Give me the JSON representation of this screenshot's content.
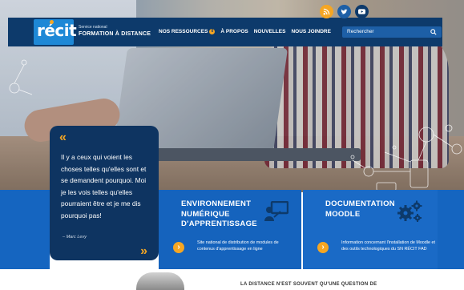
{
  "header": {
    "logo_text": "récit",
    "brand_subtitle": "Service national",
    "brand_title": "FORMATION À DISTANCE",
    "nav_items": [
      {
        "label": "NOS RESSOURCES",
        "badge": "0"
      },
      {
        "label": "À PROPOS"
      },
      {
        "label": "NOUVELLES"
      },
      {
        "label": "NOUS JOINDRE"
      }
    ],
    "search_placeholder": "Rechercher",
    "social": [
      {
        "icon": "rss-icon",
        "color": "#f5a623"
      },
      {
        "icon": "twitter-icon",
        "color": "#1d5fa6"
      },
      {
        "icon": "youtube-icon",
        "color": "#0d3a6b"
      }
    ]
  },
  "quote": {
    "text": "Il y a ceux qui voient les choses telles qu'elles sont et se demandent pourquoi. Moi je les vois telles qu'elles pourraient être et je me dis pourquoi pas!",
    "author": "– Marc Levy"
  },
  "cards": [
    {
      "title_lines": [
        "ENVIRONNEMENT",
        "NUMÉRIQUE",
        "D'APPRENTISSAGE"
      ],
      "description": "Site national de distribution de modules de contenus d'apprentissage en ligne",
      "icon": "presentation-icon"
    },
    {
      "title_lines": [
        "DOCUMENTATION",
        "MOODLE"
      ],
      "description": "Information concernant l'installation de Moodle et des outils technologiques du SN RÉCIT FAD",
      "icon": "gears-icon"
    }
  ],
  "bottom": {
    "teaser": "LA DISTANCE N'EST SOUVENT QU'UNE QUESTION DE"
  },
  "colors": {
    "navy": "#0d3a6b",
    "blue": "#1565c0",
    "accent": "#f5a623"
  }
}
